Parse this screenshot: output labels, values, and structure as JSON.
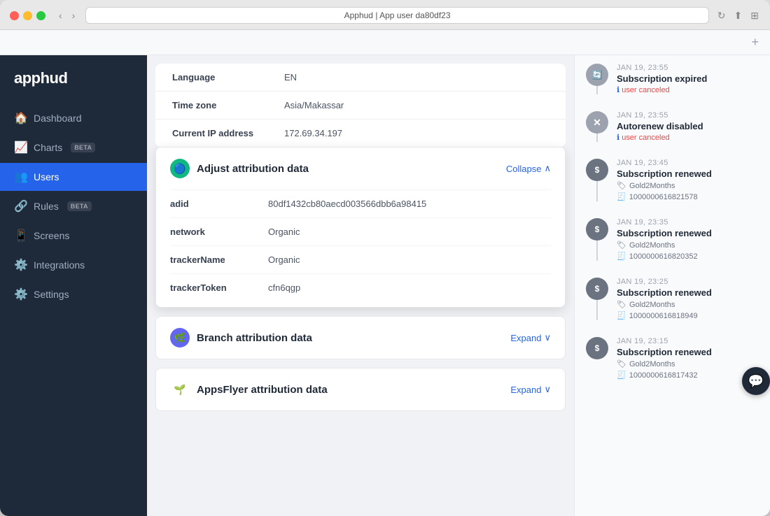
{
  "browser": {
    "title": "Apphud | App user da80df23",
    "add_tab_label": "+"
  },
  "sidebar": {
    "logo": "apphud",
    "items": [
      {
        "id": "dashboard",
        "label": "Dashboard",
        "icon": "🏠",
        "badge": null,
        "active": false
      },
      {
        "id": "charts",
        "label": "Charts",
        "icon": "📈",
        "badge": "BETA",
        "active": false
      },
      {
        "id": "users",
        "label": "Users",
        "icon": "👥",
        "badge": null,
        "active": true
      },
      {
        "id": "rules",
        "label": "Rules",
        "icon": "🔗",
        "badge": "BETA",
        "active": false
      },
      {
        "id": "screens",
        "label": "Screens",
        "icon": "📱",
        "badge": null,
        "active": false
      },
      {
        "id": "integrations",
        "label": "Integrations",
        "icon": "⚙️",
        "badge": null,
        "active": false
      },
      {
        "id": "settings",
        "label": "Settings",
        "icon": "⚙️",
        "badge": null,
        "active": false
      }
    ]
  },
  "main": {
    "top_rows": [
      {
        "label": "Language",
        "value": "EN"
      },
      {
        "label": "Time zone",
        "value": "Asia/Makassar"
      },
      {
        "label": "Current IP address",
        "value": "172.69.34.197"
      }
    ],
    "adjust": {
      "title": "Adjust attribution data",
      "expanded": true,
      "collapse_label": "Collapse",
      "rows": [
        {
          "key": "adid",
          "value": "80df1432cb80aecd003566dbb6a98415"
        },
        {
          "key": "network",
          "value": "Organic"
        },
        {
          "key": "trackerName",
          "value": "Organic"
        },
        {
          "key": "trackerToken",
          "value": "cfn6qgp"
        }
      ]
    },
    "branch": {
      "title": "Branch attribution data",
      "expanded": false,
      "expand_label": "Expand"
    },
    "appsflyer": {
      "title": "AppsFlyer attribution data",
      "expanded": false,
      "expand_label": "Expand"
    }
  },
  "timeline": {
    "items": [
      {
        "date": "JAN 19, 23:55",
        "title": "Subscription expired",
        "badge": "user canceled",
        "badge_type": "info",
        "icon": "🔄",
        "icon_type": "expired",
        "subs": []
      },
      {
        "date": "JAN 19, 23:55",
        "title": "Autorenew disabled",
        "badge": "user canceled",
        "badge_type": "info",
        "icon": "✕",
        "icon_type": "disabled",
        "subs": []
      },
      {
        "date": "JAN 19, 23:45",
        "title": "Subscription renewed",
        "badge": null,
        "icon": "$",
        "icon_type": "renewed",
        "subs": [
          {
            "product": "Gold2Months",
            "id": "1000000616821578"
          }
        ]
      },
      {
        "date": "JAN 19, 23:35",
        "title": "Subscription renewed",
        "badge": null,
        "icon": "$",
        "icon_type": "renewed",
        "subs": [
          {
            "product": "Gold2Months",
            "id": "1000000616820352"
          }
        ]
      },
      {
        "date": "JAN 19, 23:25",
        "title": "Subscription renewed",
        "badge": null,
        "icon": "$",
        "icon_type": "renewed",
        "subs": [
          {
            "product": "Gold2Months",
            "id": "1000000616818949"
          }
        ]
      },
      {
        "date": "JAN 19, 23:15",
        "title": "Subscription renewed",
        "badge": null,
        "icon": "$",
        "icon_type": "renewed",
        "subs": [
          {
            "product": "Gold2Months",
            "id": "1000000616817432"
          }
        ]
      }
    ]
  }
}
